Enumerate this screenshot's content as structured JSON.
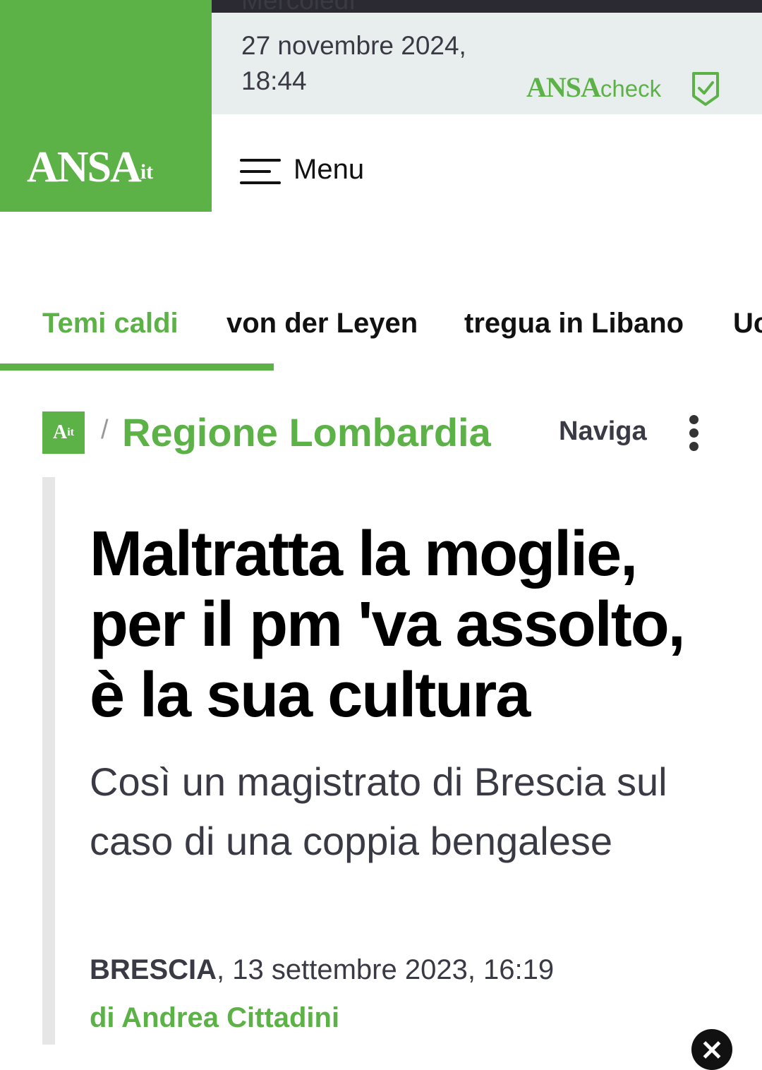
{
  "header": {
    "logo": "ANSA",
    "logo_suffix": "it",
    "date_weekday": "Mercoledì",
    "date": "27 novembre 2024,",
    "time": "18:44",
    "ansacheck_brand": "ANSA",
    "ansacheck_word": "check",
    "menu_label": "Menu"
  },
  "topics": {
    "items": [
      {
        "label": "Temi caldi"
      },
      {
        "label": "von der Leyen"
      },
      {
        "label": "tregua in Libano"
      },
      {
        "label": "Ucraina"
      }
    ]
  },
  "section": {
    "logo_main": "A",
    "logo_sub": "it",
    "title": "Regione Lombardia",
    "naviga": "Naviga"
  },
  "article": {
    "headline": "Maltratta la moglie, per il pm 'va assolto, è la sua cultura",
    "subtitle": "Così un magistrato di Brescia sul caso di una coppia bengalese",
    "city": "BRESCIA",
    "datetime": ", 13 settembre 2023, 16:19",
    "byline": "di Andrea Cittadini"
  },
  "colors": {
    "brand_green": "#5cb247",
    "topbar_bg": "#e8eeee",
    "text_dark": "#111111"
  }
}
